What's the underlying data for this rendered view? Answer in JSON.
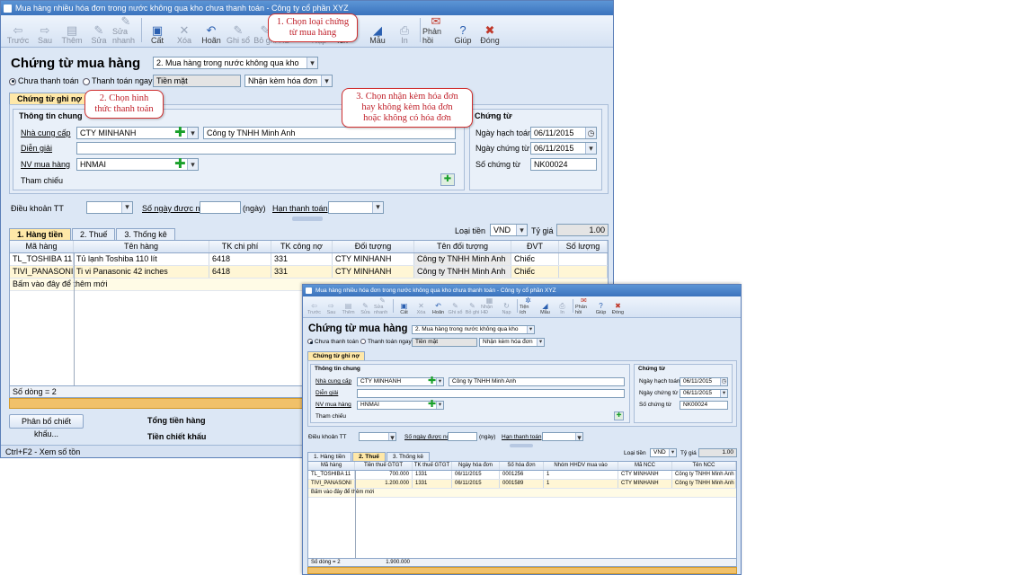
{
  "win1": {
    "title": "Mua hàng nhiều hóa đơn trong nước không qua kho chưa thanh toán - Công ty cổ  phần XYZ",
    "toolbar": [
      {
        "label": "Trước",
        "icon": "arrow-left-icon",
        "glyph": "⇦",
        "disabled": true
      },
      {
        "label": "Sau",
        "icon": "arrow-right-icon",
        "glyph": "⇨",
        "disabled": true
      },
      {
        "label": "Thêm",
        "icon": "add-doc-icon",
        "glyph": "▤",
        "disabled": true
      },
      {
        "label": "Sửa",
        "icon": "edit-doc-icon",
        "glyph": "✎",
        "disabled": true
      },
      {
        "label": "Sửa nhanh",
        "icon": "quick-edit-icon",
        "glyph": "✎",
        "disabled": true
      },
      {
        "label": "Cất",
        "icon": "save-icon",
        "glyph": "▣",
        "disabled": false
      },
      {
        "label": "Xóa",
        "icon": "delete-icon",
        "glyph": "✕",
        "disabled": true
      },
      {
        "label": "Hoãn",
        "icon": "undo-icon",
        "glyph": "↶",
        "disabled": false
      },
      {
        "label": "Ghi sổ",
        "icon": "post-icon",
        "glyph": "✎",
        "disabled": true
      },
      {
        "label": "Bỏ ghi",
        "icon": "unpost-icon",
        "glyph": "✎",
        "disabled": true
      },
      {
        "label": "Nhận HĐ",
        "icon": "receive-invoice-icon",
        "glyph": "▦",
        "disabled": true
      },
      {
        "label": "Nạp",
        "icon": "load-icon",
        "glyph": "↻",
        "disabled": true
      },
      {
        "label": "Tiện ích",
        "icon": "utility-icon",
        "glyph": "✲",
        "disabled": false
      },
      {
        "label": "Mẫu",
        "icon": "template-icon",
        "glyph": "◢",
        "disabled": false
      },
      {
        "label": "In",
        "icon": "print-icon",
        "glyph": "⎙",
        "disabled": true
      },
      {
        "label": "Phản hồi",
        "icon": "feedback-icon",
        "glyph": "✉",
        "disabled": false
      },
      {
        "label": "Giúp",
        "icon": "help-icon",
        "glyph": "?",
        "disabled": false
      },
      {
        "label": "Đóng",
        "icon": "close-icon",
        "glyph": "✖",
        "disabled": false
      }
    ],
    "header_title": "Chứng từ mua hàng",
    "voucher_type": "2. Mua hàng trong nước không qua kho",
    "radio_unpaid": "Chưa thanh toán",
    "radio_paid": "Thanh toán ngay",
    "payment_method": "Tiền mặt",
    "invoice_option": "Nhận kèm hóa đơn",
    "voucher_tab": "Chứng từ ghi nợ",
    "general_info": "Thông tin chung",
    "supplier_label": "Nhà cung cấp",
    "supplier_code": "CTY MINHANH",
    "supplier_name": "Công ty TNHH Minh Anh",
    "description_label": "Diễn giải",
    "staff_label": "NV mua hàng",
    "staff_value": "HNMAI",
    "reference_label": "Tham chiếu",
    "voucher_group": "Chứng từ",
    "posting_date_label": "Ngày hạch toán",
    "posting_date": "06/11/2015",
    "voucher_date_label": "Ngày chứng từ",
    "voucher_date": "06/11/2015",
    "voucher_no_label": "Số chứng từ",
    "voucher_no": "NK00024",
    "payment_terms_label": "Điều khoản TT",
    "days_label": "Số ngày được nợ",
    "days_unit": "(ngày)",
    "due_label": "Hạn thanh toán",
    "currency_label": "Loại tiền",
    "currency": "VND",
    "rate_label": "Tỷ giá",
    "rate": "1.00",
    "tabs": [
      "1. Hàng tiền",
      "2. Thuế",
      "3. Thống kê"
    ],
    "columns": [
      "Mã hàng",
      "Tên hàng",
      "TK chi phí",
      "TK công nợ",
      "Đối tượng",
      "Tên đối tượng",
      "ĐVT",
      "Số lượng"
    ],
    "rows": [
      [
        "TL_TOSHIBA 11",
        "Tủ lạnh Toshiba 110 lít",
        "6418",
        "331",
        "CTY MINHANH",
        "Công ty TNHH Minh Anh",
        "Chiếc",
        ""
      ],
      [
        "TIVI_PANASONI",
        "Ti vi Panasonic 42 inches",
        "6418",
        "331",
        "CTY MINHANH",
        "Công ty TNHH Minh Anh",
        "Chiếc",
        ""
      ]
    ],
    "add_row_hint": "Bấm vào đây để thêm mới",
    "row_count": "Số dòng = 2",
    "allocate_button": "Phân bổ chiết khấu...",
    "total_label": "Tổng tiền hàng",
    "discount_label": "Tiền chiết khấu",
    "status_bar": "Ctrl+F2 - Xem số tồn"
  },
  "callouts": {
    "c1": "1. Chọn loại chứng\ntừ mua hàng",
    "c2": "2. Chọn hình\nthức thanh toán",
    "c3": "3. Chọn nhận kèm hóa đơn\nhay không kèm hóa đơn\nhoặc không có hóa đơn"
  },
  "win2": {
    "title": "Mua hàng nhiều hóa đơn trong nước không qua kho chưa thanh toán - Công ty cổ  phần XYZ",
    "header_title": "Chứng từ mua hàng",
    "voucher_type": "2. Mua hàng trong nước không qua kho",
    "radio_unpaid": "Chưa thanh toán",
    "radio_paid": "Thanh toán ngay",
    "payment_method": "Tiền mặt",
    "invoice_option": "Nhận kèm hóa đơn",
    "voucher_tab": "Chứng từ ghi nợ",
    "general_info": "Thông tin chung",
    "supplier_label": "Nhà cung cấp",
    "supplier_code": "CTY MINHANH",
    "supplier_name": "Công ty TNHH Minh Anh",
    "description_label": "Diễn giải",
    "staff_label": "NV mua hàng",
    "staff_value": "HNMAI",
    "reference_label": "Tham chiếu",
    "voucher_group": "Chứng từ",
    "posting_date_label": "Ngày hạch toán",
    "posting_date": "06/11/2015",
    "voucher_date_label": "Ngày chứng từ",
    "voucher_date": "06/11/2015",
    "voucher_no_label": "Số chứng từ",
    "voucher_no": "NK00024",
    "payment_terms_label": "Điều khoản TT",
    "days_label": "Số ngày được nợ",
    "days_unit": "(ngày)",
    "due_label": "Hạn thanh toán",
    "currency_label": "Loại tiền",
    "currency": "VND",
    "rate_label": "Tỷ giá",
    "rate": "1.00",
    "tabs": [
      "1. Hàng tiền",
      "2. Thuế",
      "3. Thống kê"
    ],
    "columns": [
      "Mã hàng",
      "Tiền thuế GTGT",
      "TK thuế GTGT",
      "Ngày hóa đơn",
      "Số hóa đơn",
      "Nhóm HHDV mua vào",
      "Mã NCC",
      "Tên NCC"
    ],
    "rows": [
      [
        "TL_TOSHIBA 11",
        "700.000",
        "1331",
        "06/11/2015",
        "0001256",
        "1",
        "CTY MINHANH",
        "Công ty TNHH Minh Anh"
      ],
      [
        "TIVI_PANASONI",
        "1.200.000",
        "1331",
        "06/11/2015",
        "0001589",
        "1",
        "CTY MINHANH",
        "Công ty TNHH Minh Anh"
      ]
    ],
    "add_row_hint": "Bấm vào đây để thêm mới",
    "row_count": "Số dòng = 2",
    "total_tax": "1.900.000"
  },
  "colors": {
    "accent": "#3b73bd",
    "callout_border": "#d03030",
    "highlight_tab": "#ffe8a8"
  }
}
